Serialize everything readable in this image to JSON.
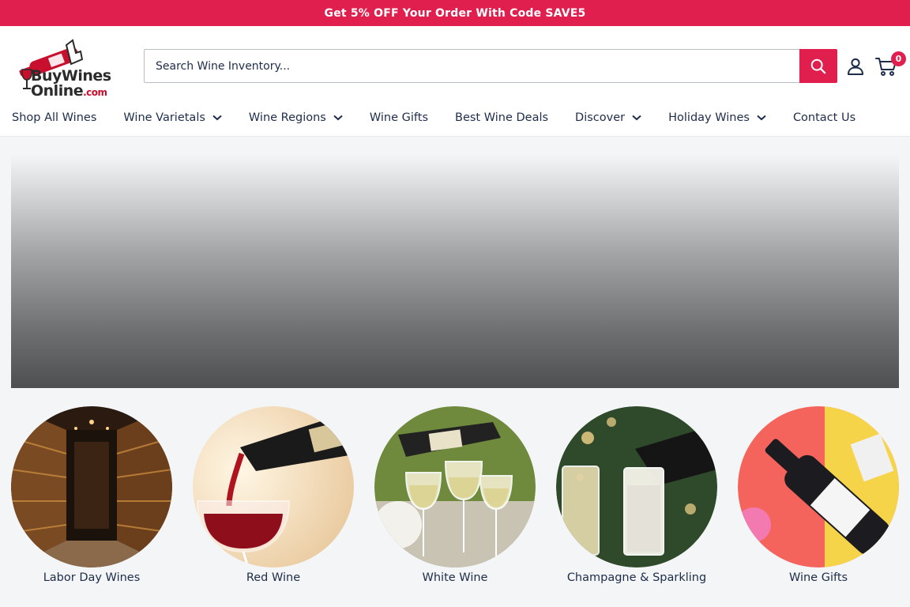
{
  "promo": {
    "text": "Get 5% OFF Your Order With Code SAVE5"
  },
  "logo": {
    "line1": "BuyWines",
    "line2": "Online",
    "suffix": ".com"
  },
  "search": {
    "placeholder": "Search Wine Inventory..."
  },
  "cart": {
    "count": "0"
  },
  "nav": {
    "items": [
      {
        "label": "Shop All Wines",
        "dropdown": false
      },
      {
        "label": "Wine Varietals",
        "dropdown": true
      },
      {
        "label": "Wine Regions",
        "dropdown": true
      },
      {
        "label": "Wine Gifts",
        "dropdown": false
      },
      {
        "label": "Best Wine Deals",
        "dropdown": false
      },
      {
        "label": "Discover",
        "dropdown": true
      },
      {
        "label": "Holiday Wines",
        "dropdown": true
      },
      {
        "label": "Contact Us",
        "dropdown": false
      }
    ]
  },
  "categories": [
    {
      "label": "Labor Day Wines"
    },
    {
      "label": "Red Wine"
    },
    {
      "label": "White Wine"
    },
    {
      "label": "Champagne & Sparkling"
    },
    {
      "label": "Wine Gifts"
    }
  ],
  "colors": {
    "accent": "#e01f4f",
    "text": "#1e2d4a",
    "page_bg": "#f3f5f6"
  },
  "icons": [
    "search-icon",
    "account-icon",
    "cart-icon",
    "chevron-down-icon"
  ]
}
